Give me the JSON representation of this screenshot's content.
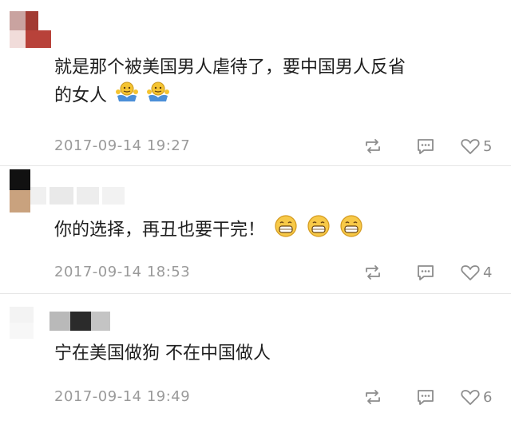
{
  "comments": [
    {
      "text_line1": "就是那个被美国男人虐待了，要中国男人反省",
      "text_line2": "的女人",
      "emoji": "shrug-emoji",
      "time": "2017-09-14 19:27",
      "likes": "5"
    },
    {
      "text": "你的选择，再丑也要干完！",
      "emoji": "grin-emoji",
      "time": "2017-09-14 18:53",
      "likes": "4"
    },
    {
      "text": "宁在美国做狗 不在中国做人",
      "time": "2017-09-14 19:49",
      "likes": "6"
    }
  ],
  "icons": {
    "repost": "repost-icon",
    "comment": "comment-bubble-icon",
    "like": "heart-icon"
  },
  "colors": {
    "text": "#1e1e1e",
    "meta": "#9a9a9a",
    "icon": "#8c8c8c",
    "divider": "#e6e6e6"
  }
}
